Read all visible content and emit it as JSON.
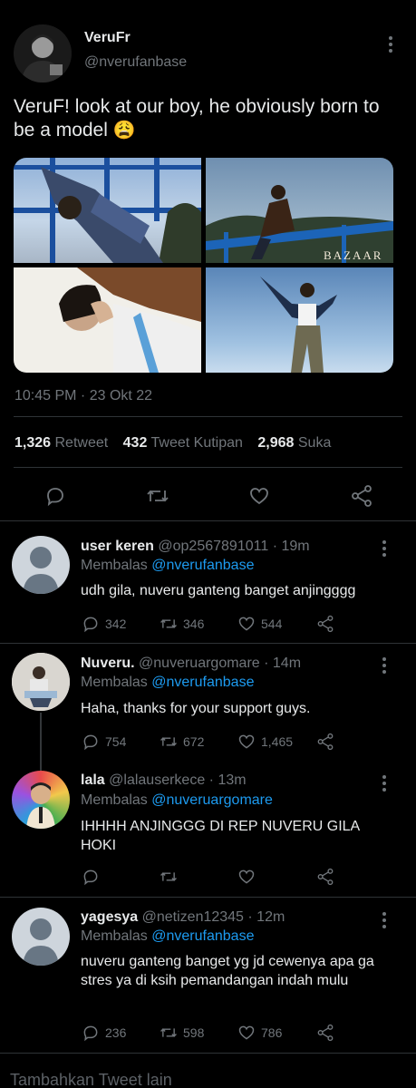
{
  "tweet": {
    "display_name": "VeruFr",
    "handle": "@nveruf anbase",
    "text": "VeruF! look at our boy, he obviously born to be a model",
    "emoji": "😩",
    "timestamp": "10:45 PM · 23 Okt 22",
    "watermark": "BAZAAR",
    "stats": {
      "retweets_count": "1,326",
      "retweets_label": "Retweet",
      "quotes_count": "432",
      "quotes_label": "Tweet Kutipan",
      "likes_count": "2,968",
      "likes_label": "Suka"
    }
  },
  "replies": [
    {
      "name": "user keren",
      "handle": "@op2567891011",
      "time": "· 19m",
      "replying_label": "Membalas",
      "replying_to": "@nverufanbase",
      "text": "udh gila, nuveru ganteng banget anjingggg",
      "replies": "342",
      "retweets": "346",
      "likes": "544"
    },
    {
      "name": "Nuveru.",
      "handle": "@nuveruargomare",
      "time": "· 14m",
      "replying_label": "Membalas",
      "replying_to": "@nverufanbase",
      "text": "Haha, thanks for your support guys.",
      "replies": "754",
      "retweets": "672",
      "likes": "1,465"
    },
    {
      "name": "lala",
      "handle": "@lalauserkece",
      "time": "· 13m",
      "replying_label": "Membalas",
      "replying_to": "@nuveruargomare",
      "text": "IHHHH ANJINGGG DI REP NUVERU GILA HOKI",
      "replies": "",
      "retweets": "",
      "likes": ""
    },
    {
      "name": "yagesya",
      "handle": "@netizen12345",
      "time": "· 12m",
      "replying_label": "Membalas",
      "replying_to": "@nverufanbase",
      "text": "nuveru ganteng banget yg jd cewenya apa ga stres ya di ksih pemandangan indah mulu",
      "replies": "236",
      "retweets": "598",
      "likes": "786"
    }
  ],
  "footer": {
    "add_tweet_label": "Tambahkan Tweet lain"
  },
  "colors": {
    "background": "#000000",
    "text": "#e7e9ea",
    "muted": "#71767b",
    "link": "#1d9bf0",
    "divider": "#2f3336"
  }
}
